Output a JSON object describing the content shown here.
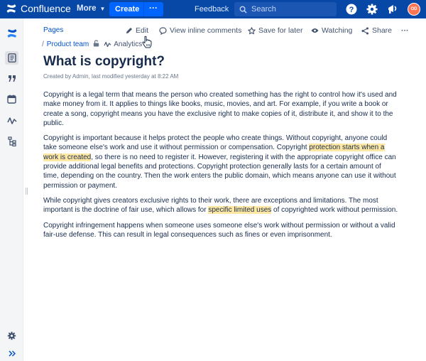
{
  "topnav": {
    "product": "Confluence",
    "more": "More",
    "create": "Create",
    "create_more": "···",
    "feedback": "Feedback",
    "search_placeholder": "Search",
    "avatar_initials": "OD",
    "brand_color": "#0747a6",
    "create_color": "#0065ff"
  },
  "page": {
    "breadcrumb_root": "Pages",
    "breadcrumb_parent": "Product team",
    "analytics": "Analytics",
    "actions": {
      "edit": "Edit",
      "comments": "View inline comments",
      "save": "Save for later",
      "watching": "Watching",
      "share": "Share",
      "more": "···"
    },
    "title": "What is copyright?",
    "byline": "Created by Admin, last modified yesterday at 8:22 AM"
  },
  "body": {
    "p1": "Copyright is a legal term that means the person who created something has the right to control how it's used and make money from it. It applies to things like books, music, movies, and art. For example, if you write a book or create a song, copyright means you have the exclusive right to make copies of it, distribute it, and show it to the public.",
    "p2_a": "Copyright is important because it helps protect the people who create things. Without copyright, anyone could take someone else's work and use it without permission or compensation. Copyright ",
    "p2_hl": "protection starts when a work is created",
    "p2_b": ", so there is no need to register it. However, registering it with the appropriate copyright office can provide additional legal benefits and protections. Copyright protection generally lasts for a certain amount of time, depending on the country. Then the work enters the public domain, which means anyone can use it without permission or payment.",
    "p3_a": "While copyright gives creators exclusive rights to their work, there are exceptions and limitations. The most important is the doctrine of fair use, which allows for ",
    "p3_hl": "specific limited uses",
    "p3_b": " of copyrighted work without permission.",
    "p4": "Copyright infringement happens when someone uses someone else's work without permission or without a valid fair-use defense. This can result in legal consequences such as fines or even imprisonment."
  },
  "colors": {
    "highlight": "#ffe8a3",
    "link": "#0052cc"
  }
}
